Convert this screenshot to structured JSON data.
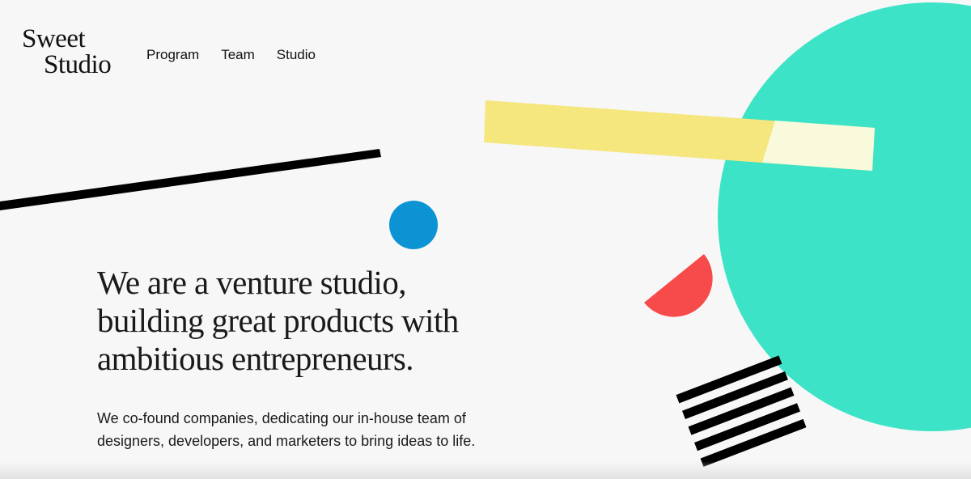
{
  "brand": {
    "line1": "Sweet",
    "line2": "Studio"
  },
  "nav": {
    "items": [
      {
        "label": "Program"
      },
      {
        "label": "Team"
      },
      {
        "label": "Studio"
      }
    ]
  },
  "hero": {
    "headline": "We are a venture studio, building great products with ambitious entrepreneurs.",
    "subtext": "We co-found companies, dedicating our in-house team of designers, developers, and marketers to bring ideas to life."
  },
  "colors": {
    "background": "#f7f7f7",
    "teal": "#3de3c7",
    "yellow": "#f5e67e",
    "pale_yellow": "#f8fadb",
    "blue": "#0b93d4",
    "red": "#f74a4a",
    "black": "#000000"
  }
}
